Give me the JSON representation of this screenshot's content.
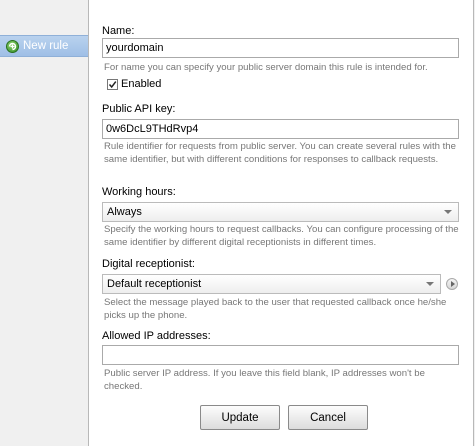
{
  "sidebar": {
    "new_rule_label": "New rule"
  },
  "form": {
    "name": {
      "label": "Name:",
      "value": "yourdomain",
      "hint": "For name you can specify your public server domain this rule is intended for."
    },
    "enabled": {
      "label": "Enabled",
      "checked": true
    },
    "api_key": {
      "label": "Public API key:",
      "value": "0w6DcL9THdRvp4",
      "hint": "Rule identifier for requests from public server. You can create several rules with the same identifier, but with different conditions for responses to callback requests."
    },
    "working_hours": {
      "label": "Working hours:",
      "value": "Always",
      "hint": "Specify the working hours to request callbacks. You can configure processing of the same identifier by different digital receptionists in different times."
    },
    "receptionist": {
      "label": "Digital receptionist:",
      "value": "Default receptionist",
      "hint": "Select the message played back to the user that requested callback once he/she picks up the phone."
    },
    "allowed_ip": {
      "label": "Allowed IP addresses:",
      "value": "",
      "hint": "Public server IP address. If you leave this field blank, IP addresses won't be checked."
    }
  },
  "buttons": {
    "update": "Update",
    "cancel": "Cancel"
  },
  "icons": {
    "new_rule": "add-circle-icon",
    "play": "play-icon",
    "dropdown": "chevron-down-icon",
    "check": "check-icon"
  },
  "colors": {
    "sidebar_tab": "#a9c8ec",
    "hint_text": "#777777",
    "add_icon": "#3a9a2c"
  }
}
